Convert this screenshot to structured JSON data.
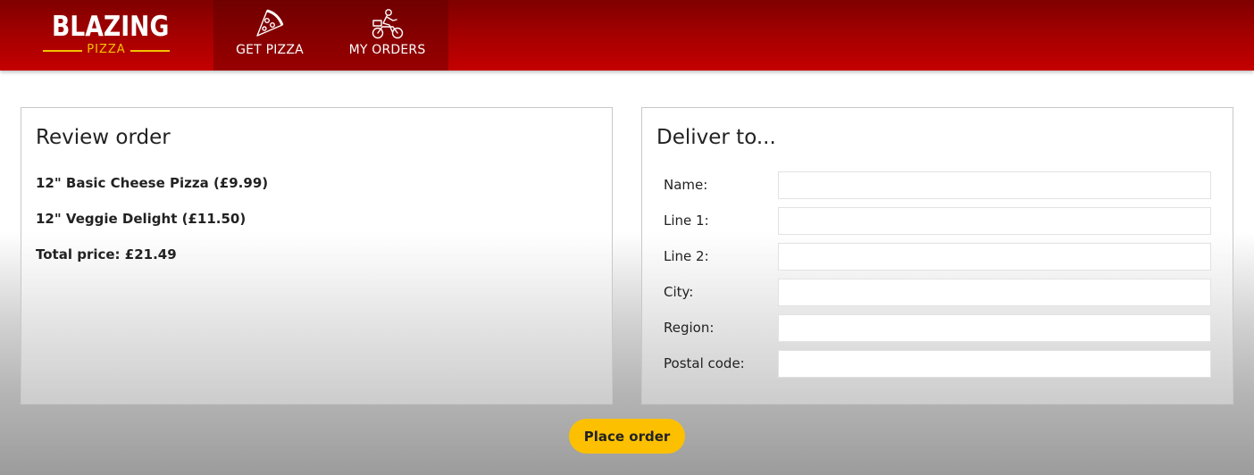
{
  "brand": {
    "name": "BLAZING",
    "subtitle": "PIZZA",
    "accent_color": "#f3c200",
    "header_color": "#b00000"
  },
  "nav": {
    "items": [
      {
        "label": "GET PIZZA",
        "icon": "pizza-slice-icon"
      },
      {
        "label": "MY ORDERS",
        "icon": "delivery-rider-icon"
      }
    ]
  },
  "review": {
    "title": "Review order",
    "items": [
      {
        "label": "12\" Basic Cheese Pizza (£9.99)"
      },
      {
        "label": "12\" Veggie Delight (£11.50)"
      }
    ],
    "total": "Total price: £21.49"
  },
  "deliver": {
    "title": "Deliver to...",
    "fields": [
      {
        "label": "Name:",
        "value": ""
      },
      {
        "label": "Line 1:",
        "value": ""
      },
      {
        "label": "Line 2:",
        "value": ""
      },
      {
        "label": "City:",
        "value": ""
      },
      {
        "label": "Region:",
        "value": ""
      },
      {
        "label": "Postal code:",
        "value": ""
      }
    ]
  },
  "actions": {
    "place_order": "Place order",
    "button_color": "#fcc000"
  }
}
